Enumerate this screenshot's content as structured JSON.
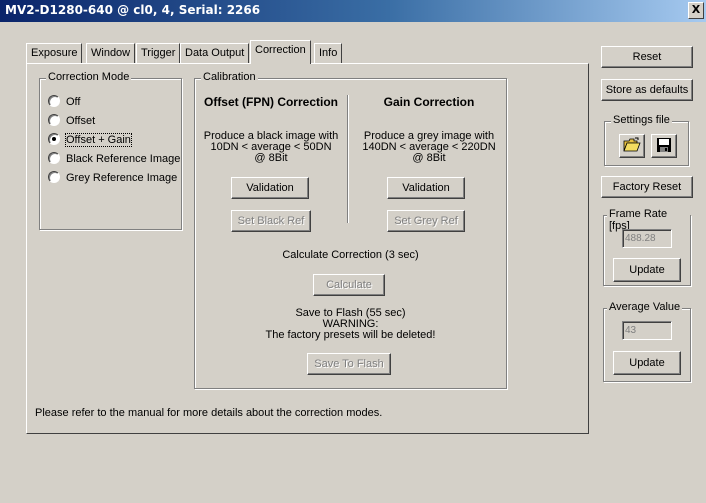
{
  "window": {
    "title": "MV2-D1280-640 @ cl0, 4, Serial: 2266",
    "close_glyph": "X"
  },
  "tabs": [
    {
      "label": "Exposure"
    },
    {
      "label": "Window"
    },
    {
      "label": "Trigger"
    },
    {
      "label": "Data Output"
    },
    {
      "label": "Correction",
      "active": true
    },
    {
      "label": "Info"
    }
  ],
  "correction_mode": {
    "title": "Correction Mode",
    "options": [
      {
        "label": "Off",
        "selected": false
      },
      {
        "label": "Offset",
        "selected": false
      },
      {
        "label": "Offset + Gain",
        "selected": true
      },
      {
        "label": "Black Reference Image",
        "selected": false
      },
      {
        "label": "Grey Reference Image",
        "selected": false
      }
    ]
  },
  "calibration": {
    "title": "Calibration",
    "offset": {
      "heading": "Offset (FPN) Correction",
      "desc_lines": [
        "Produce a black image with",
        "10DN < average < 50DN",
        "@ 8Bit"
      ],
      "validation_label": "Validation",
      "set_ref_label": "Set Black Ref"
    },
    "gain": {
      "heading": "Gain Correction",
      "desc_lines": [
        "Produce a grey image with",
        "140DN < average < 220DN",
        "@ 8Bit"
      ],
      "validation_label": "Validation",
      "set_ref_label": "Set Grey Ref"
    },
    "calculate_text": "Calculate Correction (3 sec)",
    "calculate_label": "Calculate",
    "flash_lines": [
      "Save to Flash (55 sec)",
      "WARNING:",
      "The factory presets will be deleted!"
    ],
    "save_flash_label": "Save To Flash"
  },
  "footer_note": "Please refer to the manual for more details about the correction modes.",
  "sidebar": {
    "reset_label": "Reset",
    "store_defaults_label": "Store as defaults",
    "settings_file_title": "Settings file",
    "open_icon": "open-folder-icon",
    "save_icon": "floppy-disk-icon",
    "factory_reset_label": "Factory Reset",
    "frame_rate": {
      "title": "Frame Rate [fps]",
      "value": "488.28",
      "update_label": "Update"
    },
    "average": {
      "title": "Average Value",
      "value": "43",
      "update_label": "Update"
    }
  },
  "colors": {
    "face": "#d4d0c8",
    "title_start": "#0a246a",
    "title_end": "#a6caf0",
    "disabled_text": "#808080"
  }
}
